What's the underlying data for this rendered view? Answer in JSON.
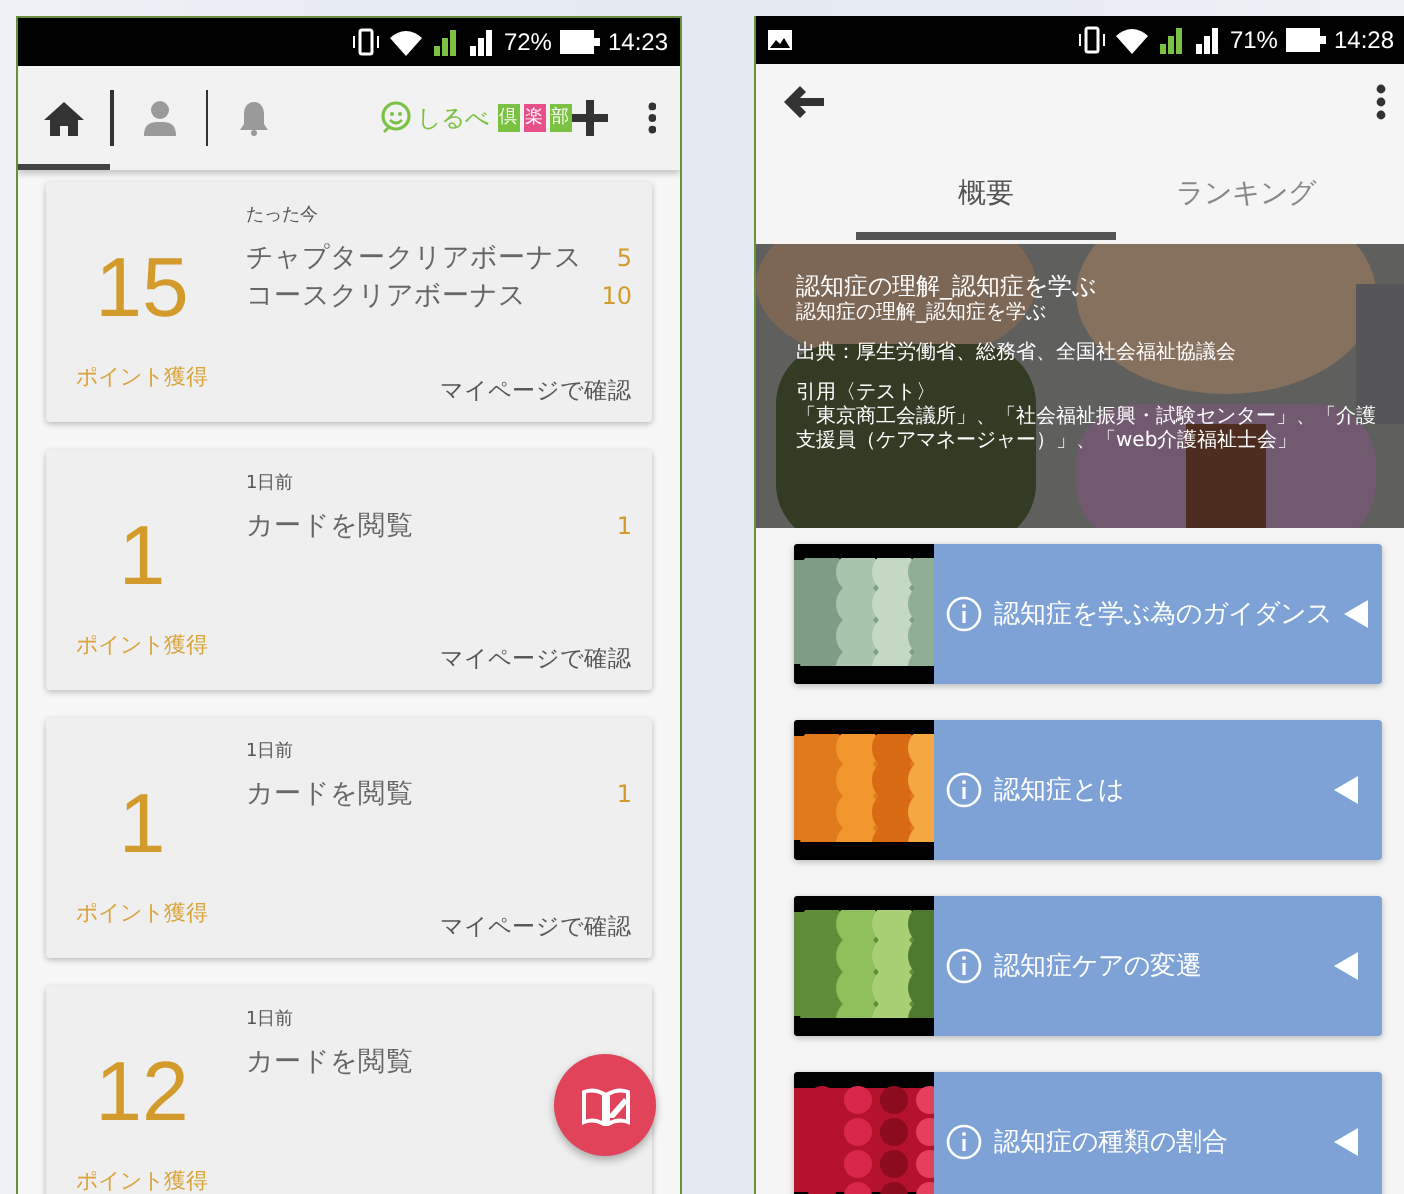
{
  "left_phone": {
    "status_bar": {
      "battery": "72%",
      "time": "14:23"
    },
    "nav_tabs": [
      {
        "kind": "home",
        "selected": true
      },
      {
        "kind": "person",
        "selected": false
      },
      {
        "kind": "bell",
        "selected": false
      }
    ],
    "logo": {
      "text": "しるべ",
      "club": [
        {
          "char": "倶",
          "color": "#7cc242"
        },
        {
          "char": "楽",
          "color": "#e8508a"
        },
        {
          "char": "部",
          "color": "#7cc242"
        }
      ]
    },
    "cards": [
      {
        "time": "たった今",
        "points": "15",
        "points_label": "ポイント獲得",
        "items": [
          {
            "name": "チャプタークリアボーナス",
            "value": "5"
          },
          {
            "name": "コースクリアボーナス",
            "value": "10"
          }
        ],
        "link": "マイページで確認"
      },
      {
        "time": "1日前",
        "points": "1",
        "points_label": "ポイント獲得",
        "items": [
          {
            "name": "カードを閲覧",
            "value": "1"
          }
        ],
        "link": "マイページで確認"
      },
      {
        "time": "1日前",
        "points": "1",
        "points_label": "ポイント獲得",
        "items": [
          {
            "name": "カードを閲覧",
            "value": "1"
          }
        ],
        "link": "マイページで確認"
      },
      {
        "time": "1日前",
        "points": "12",
        "points_label": "ポイント獲得",
        "items": [
          {
            "name": "カードを閲覧"
          }
        ]
      }
    ]
  },
  "right_phone": {
    "status_bar": {
      "battery": "71%",
      "time": "14:28"
    },
    "tabs": [
      {
        "label": "概要",
        "selected": true
      },
      {
        "label": "ランキング",
        "selected": false
      }
    ],
    "hero": {
      "title": "認知症の理解_認知症を学ぶ",
      "subtitle": "認知症の理解_認知症を学ぶ",
      "source": "出典：厚生労働省、総務省、全国社会福祉協議会",
      "citation_heading": "引用〈テスト〉",
      "citation": "「東京商工会議所」、「社会福祉振興・試験センター」、「介護支援員（ケアマネージャー）」、「web介護福祉士会」"
    },
    "lessons": [
      {
        "title": "認知症を学ぶ為のガイダンス"
      },
      {
        "title": "認知症とは"
      },
      {
        "title": "認知症ケアの変遷"
      },
      {
        "title": "認知症の種類の割合"
      }
    ]
  }
}
